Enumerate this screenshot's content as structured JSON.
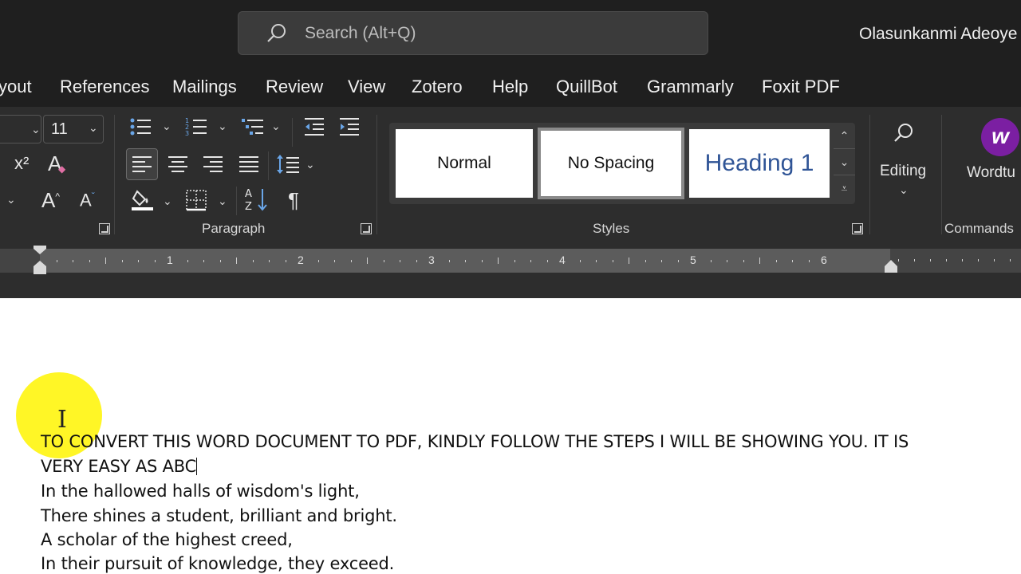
{
  "search": {
    "placeholder": "Search (Alt+Q)"
  },
  "user": {
    "name": "Olasunkanmi Adeoye"
  },
  "tabs": [
    "yout",
    "References",
    "Mailings",
    "Review",
    "View",
    "Zotero",
    "Help",
    "QuillBot",
    "Grammarly",
    "Foxit PDF"
  ],
  "font": {
    "size": "11"
  },
  "groups": {
    "paragraph": "Paragraph",
    "styles": "Styles",
    "commands": "Commands"
  },
  "styles": [
    {
      "label": "Normal"
    },
    {
      "label": "No Spacing"
    },
    {
      "label": "Heading 1"
    }
  ],
  "editing": {
    "label": "Editing"
  },
  "wordtune": {
    "label": "Wordtu"
  },
  "ruler": {
    "numbers": [
      "1",
      "2",
      "3",
      "4",
      "5",
      "6"
    ]
  },
  "document": {
    "lines": [
      "TO CONVERT THIS WORD DOCUMENT TO PDF, KINDLY FOLLOW THE STEPS I WILL BE SHOWING YOU. IT IS",
      "VERY EASY AS ABC",
      "In the hallowed halls of wisdom's light,",
      "There shines a student, brilliant and bright.",
      "A scholar of the highest creed,",
      "In their pursuit of knowledge, they exceed."
    ]
  },
  "colors": {
    "heading_blue": "#2f5496",
    "cursor_highlight": "#fff500",
    "ribbon_bg": "#2d2d2d",
    "titlebar_bg": "#1f1f1f"
  }
}
